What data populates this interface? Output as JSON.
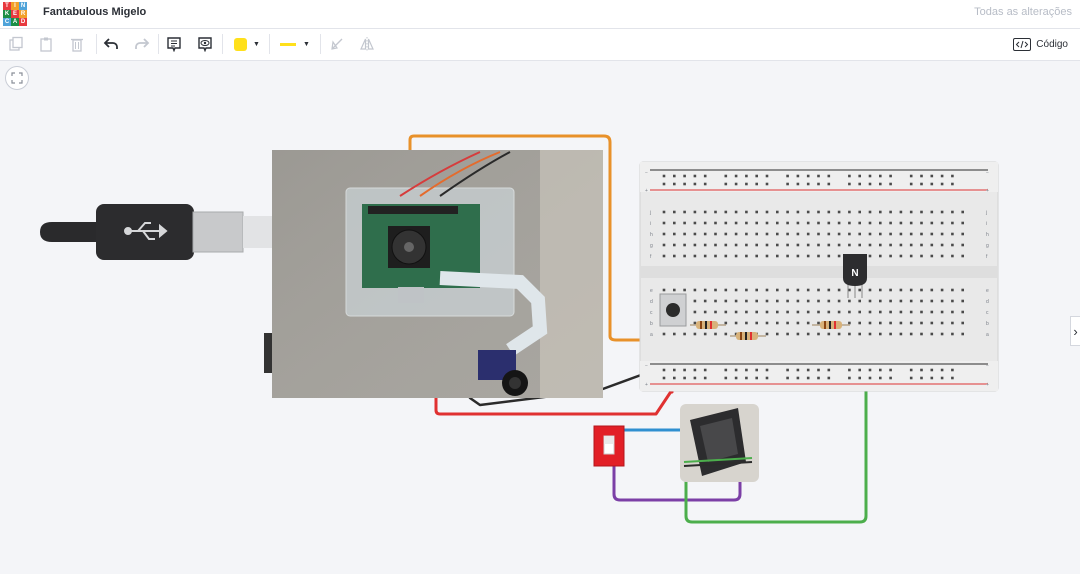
{
  "app": {
    "logo_letters": [
      "TIN",
      "KER",
      "CAD"
    ],
    "logo_colors": [
      "#e8393f",
      "#f2a02a",
      "#4fa3d9",
      "#1c8f47",
      "#e8393f",
      "#f2a02a",
      "#4fa3d9",
      "#1c8f47",
      "#e8393f"
    ],
    "title": "Fantabulous Migelo",
    "save_status": "Todas as alterações"
  },
  "toolbar": {
    "items": [
      {
        "name": "copy-icon"
      },
      {
        "name": "paste-icon"
      },
      {
        "name": "delete-icon"
      },
      {
        "name": "undo-icon"
      },
      {
        "name": "redo-icon"
      },
      {
        "name": "note-icon"
      },
      {
        "name": "visibility-icon"
      },
      {
        "name": "color-picker",
        "color": "#ffe01b"
      },
      {
        "name": "wire-style-picker",
        "color": "#ffe01b"
      },
      {
        "name": "rotate-icon"
      },
      {
        "name": "mirror-icon"
      }
    ],
    "code_label": "Código"
  },
  "breadboard": {
    "row_letters_top": [
      "j",
      "i",
      "h",
      "g",
      "f"
    ],
    "row_letters_bottom": [
      "e",
      "d",
      "c",
      "b",
      "a"
    ],
    "rail_plus": "+",
    "rail_minus": "−",
    "transistor_label": "N"
  },
  "colors": {
    "wire_orange": "#e8912a",
    "wire_red": "#e03131",
    "wire_green": "#4cae4c",
    "wire_blue": "#2f8fd0",
    "wire_yellow": "#f0d21b",
    "wire_purple": "#7b3fa6",
    "wire_black": "#2b2b2b",
    "switch_red": "#e21f26"
  }
}
